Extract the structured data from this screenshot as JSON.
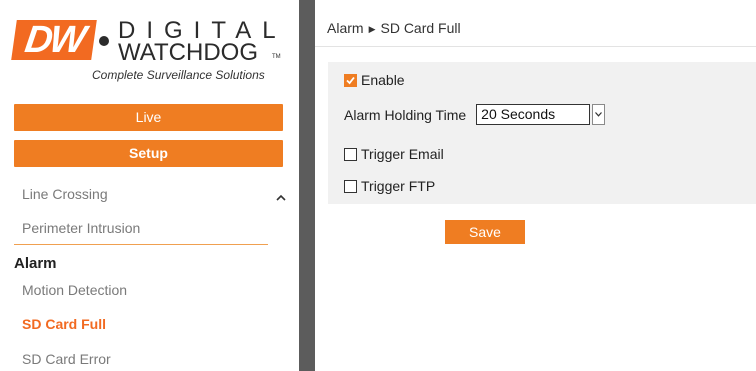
{
  "brand": {
    "logo_mark": "DW",
    "logo_line1": "DIGITAL",
    "logo_line2": "WATCHDOG",
    "logo_tm": "TM",
    "tagline": "Complete Surveillance Solutions",
    "accent_color": "#ef7d22"
  },
  "top_buttons": {
    "live_label": "Live",
    "setup_label": "Setup"
  },
  "nav": {
    "items_before": [
      {
        "label": "Line Crossing"
      },
      {
        "label": "Perimeter Intrusion"
      }
    ],
    "section_title": "Alarm",
    "section_items": [
      {
        "label": "Motion Detection",
        "active": false
      },
      {
        "label": "SD Card Full",
        "active": true
      },
      {
        "label": "SD Card Error",
        "active": false
      }
    ],
    "scroll_icon": "chevron-up-icon"
  },
  "breadcrumb": {
    "parent": "Alarm",
    "separator_icon": "triangle-right-icon",
    "current": "SD Card Full"
  },
  "form": {
    "enable_label": "Enable",
    "enable_checked": true,
    "holding_time_label": "Alarm Holding Time",
    "holding_time_value": "20 Seconds",
    "trigger_email_label": "Trigger Email",
    "trigger_email_checked": false,
    "trigger_ftp_label": "Trigger FTP",
    "trigger_ftp_checked": false
  },
  "actions": {
    "save_label": "Save"
  }
}
